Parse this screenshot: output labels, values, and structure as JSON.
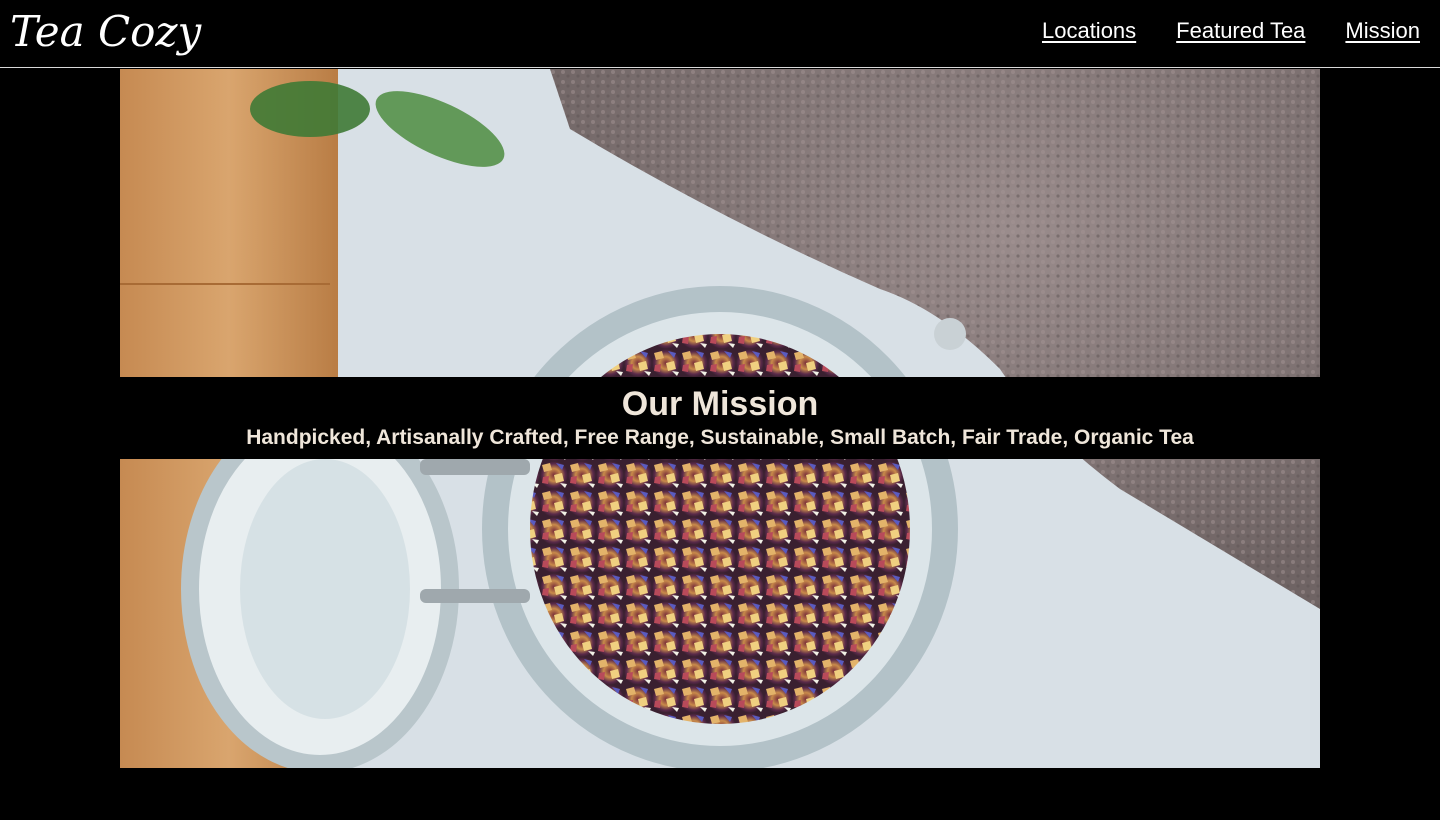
{
  "header": {
    "logo_text": "Tea Cozy",
    "nav": [
      {
        "label": "Locations"
      },
      {
        "label": "Featured Tea"
      },
      {
        "label": "Mission"
      }
    ]
  },
  "mission": {
    "title": "Our Mission",
    "subtitle": "Handpicked, Artisanally Crafted, Free Range, Sustainable, Small Batch, Fair Trade, Organic Tea"
  },
  "colors": {
    "background": "#000000",
    "text": "#efe6da",
    "nav_text": "#ffffff",
    "divider": "#d9d9d9"
  },
  "hero_image": {
    "subject": "jar of loose-leaf flower tea on table"
  }
}
